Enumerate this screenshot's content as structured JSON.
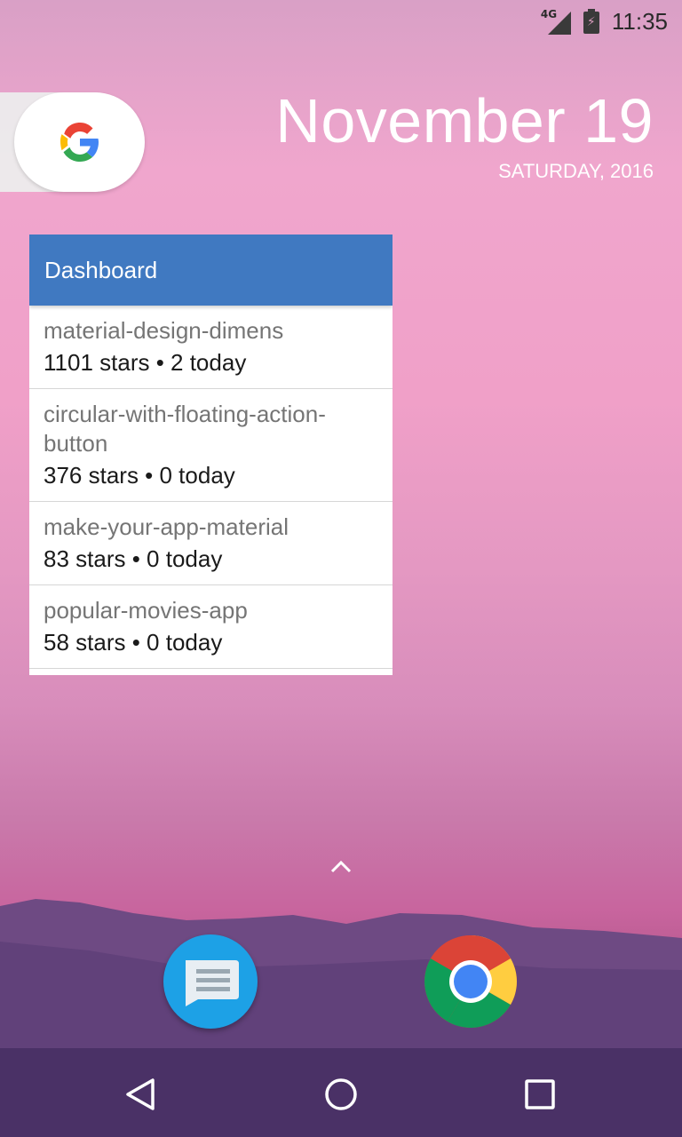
{
  "status_bar": {
    "network": "4G",
    "time": "11:35"
  },
  "date_widget": {
    "date": "November 19",
    "weekday_year": "SATURDAY, 2016"
  },
  "dashboard_widget": {
    "title": "Dashboard",
    "repos": [
      {
        "name": "material-design-dimens",
        "stats": "1101 stars • 2 today"
      },
      {
        "name": "circular-with-floating-action-button",
        "stats": "376 stars • 0 today"
      },
      {
        "name": "make-your-app-material",
        "stats": "83 stars • 0 today"
      },
      {
        "name": "popular-movies-app",
        "stats": "58 stars • 0 today"
      }
    ]
  },
  "dock": {
    "apps": [
      {
        "icon": "messages-icon"
      },
      {
        "icon": "chrome-icon"
      }
    ]
  },
  "nav_bar": {
    "buttons": [
      "back-icon",
      "home-icon",
      "recents-icon"
    ]
  },
  "colors": {
    "widget_header": "#4079c1",
    "messages_app": "#1da1e6"
  }
}
